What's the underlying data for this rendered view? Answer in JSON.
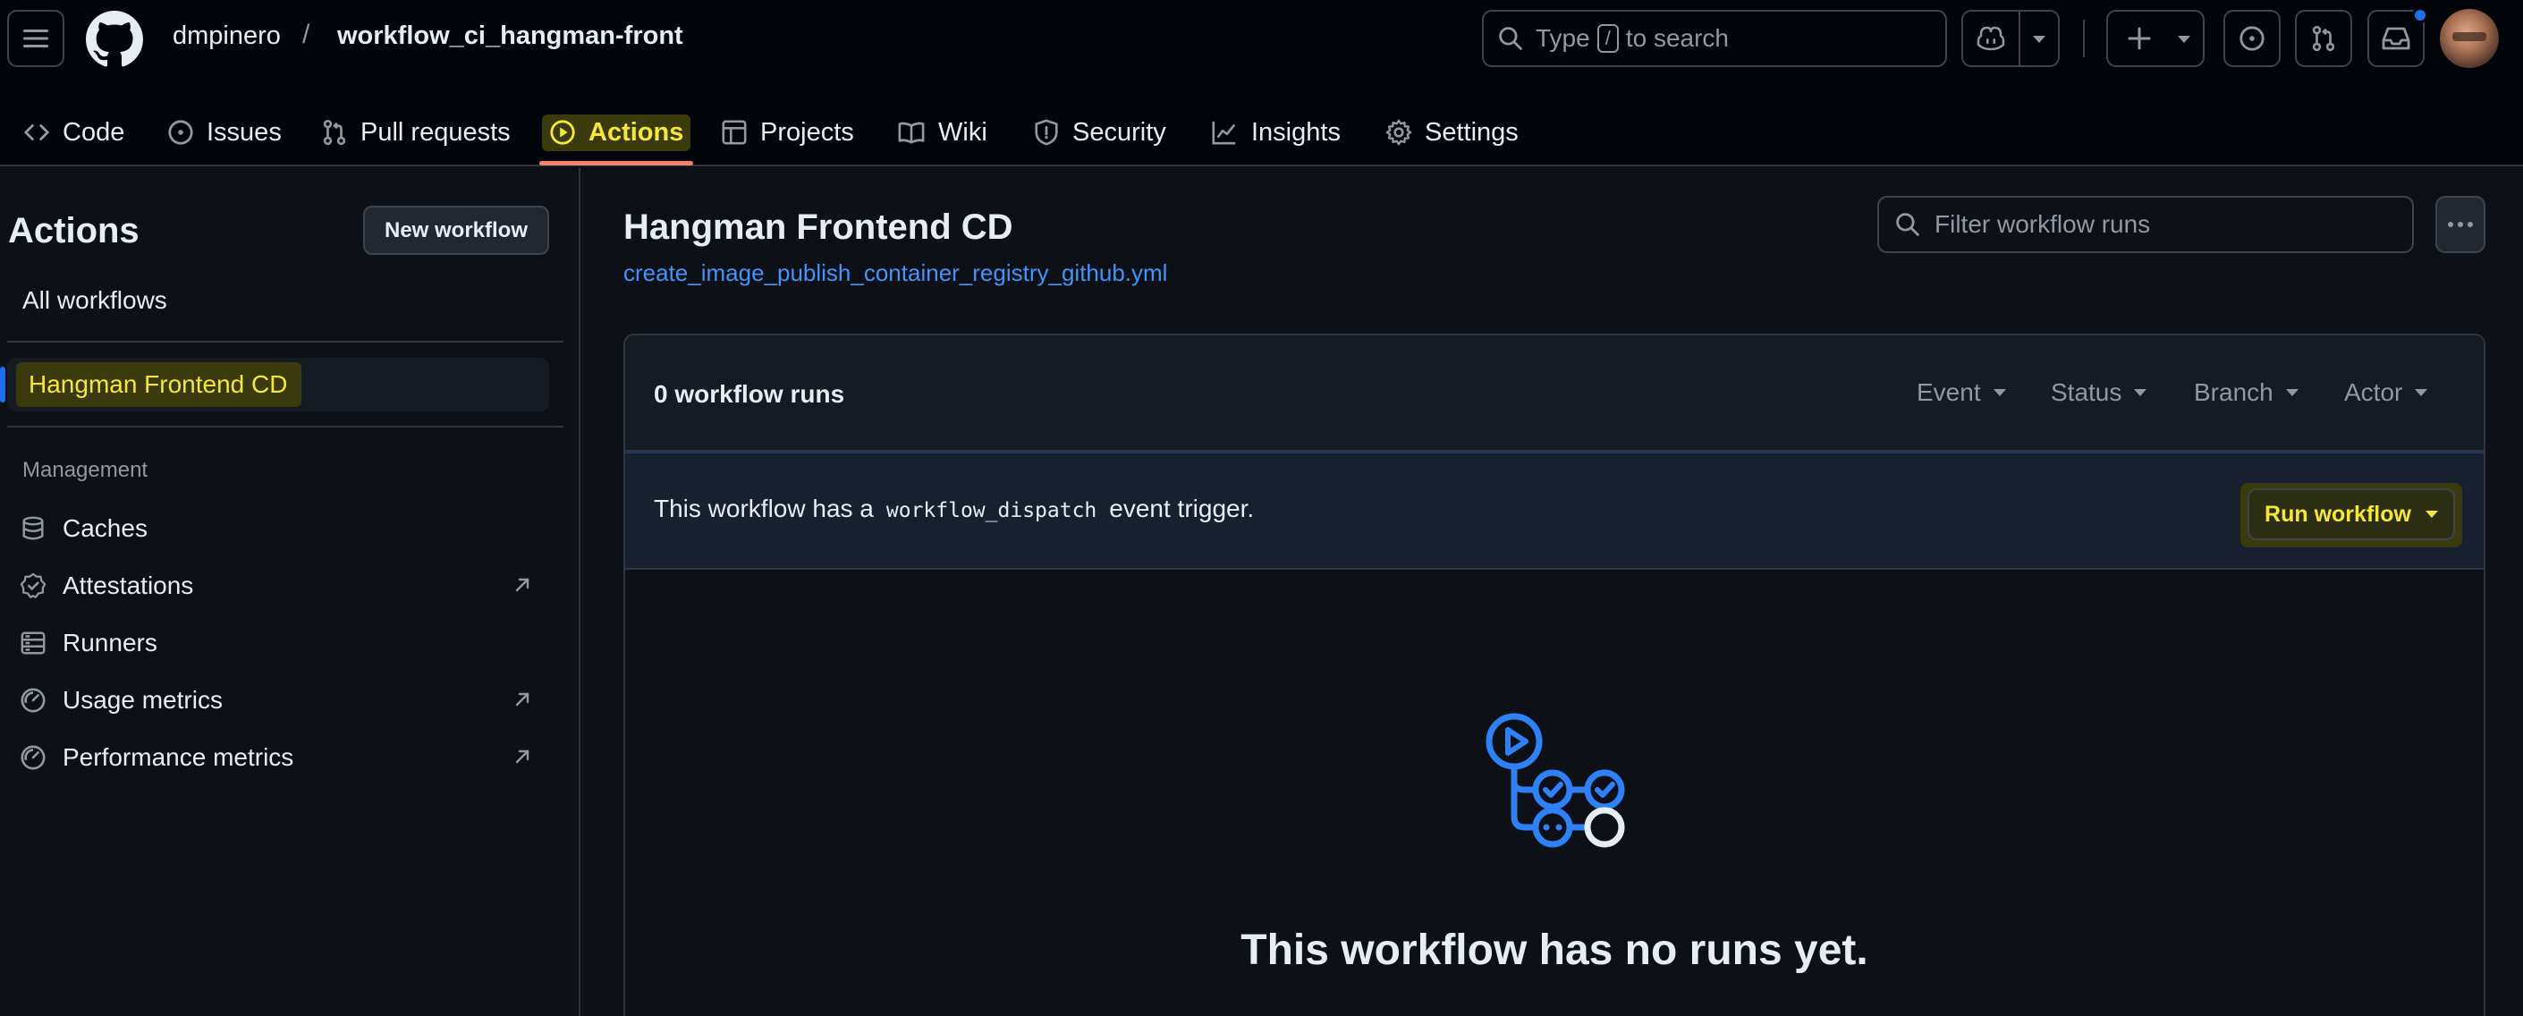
{
  "header": {
    "owner": "dmpinero",
    "separator": "/",
    "repo": "workflow_ci_hangman-front",
    "search": {
      "prefix": "Type",
      "key": "/",
      "suffix": "to search"
    }
  },
  "tabs": [
    {
      "label": "Code",
      "icon": "code-icon"
    },
    {
      "label": "Issues",
      "icon": "issue-opened-icon"
    },
    {
      "label": "Pull requests",
      "icon": "git-pull-request-icon"
    },
    {
      "label": "Actions",
      "icon": "play-icon",
      "active": true
    },
    {
      "label": "Projects",
      "icon": "table-icon"
    },
    {
      "label": "Wiki",
      "icon": "book-icon"
    },
    {
      "label": "Security",
      "icon": "shield-icon"
    },
    {
      "label": "Insights",
      "icon": "graph-icon"
    },
    {
      "label": "Settings",
      "icon": "gear-icon"
    }
  ],
  "sidebar": {
    "title": "Actions",
    "new_workflow": "New workflow",
    "all_workflows": "All workflows",
    "workflows": [
      {
        "label": "Hangman Frontend CD",
        "active": true
      }
    ],
    "management_heading": "Management",
    "management": [
      {
        "label": "Caches",
        "icon": "database-icon",
        "external": false
      },
      {
        "label": "Attestations",
        "icon": "verified-icon",
        "external": true
      },
      {
        "label": "Runners",
        "icon": "server-icon",
        "external": false
      },
      {
        "label": "Usage metrics",
        "icon": "meter-icon",
        "external": true
      },
      {
        "label": "Performance metrics",
        "icon": "meter-icon",
        "external": true
      }
    ]
  },
  "main": {
    "title": "Hangman Frontend CD",
    "file": "create_image_publish_container_registry_github.yml",
    "filter_placeholder": "Filter workflow runs",
    "runs_count": "0 workflow runs",
    "filters": [
      "Event",
      "Status",
      "Branch",
      "Actor"
    ],
    "dispatch": {
      "text_before": "This workflow has a",
      "code": "workflow_dispatch",
      "text_after": "event trigger."
    },
    "run_workflow": "Run workflow",
    "empty_title": "This workflow has no runs yet."
  },
  "colors": {
    "background": "#0d1117",
    "header": "#010409",
    "accent": "#4493f8",
    "active_underline": "#f78166",
    "highlight": "#f7e63a"
  }
}
